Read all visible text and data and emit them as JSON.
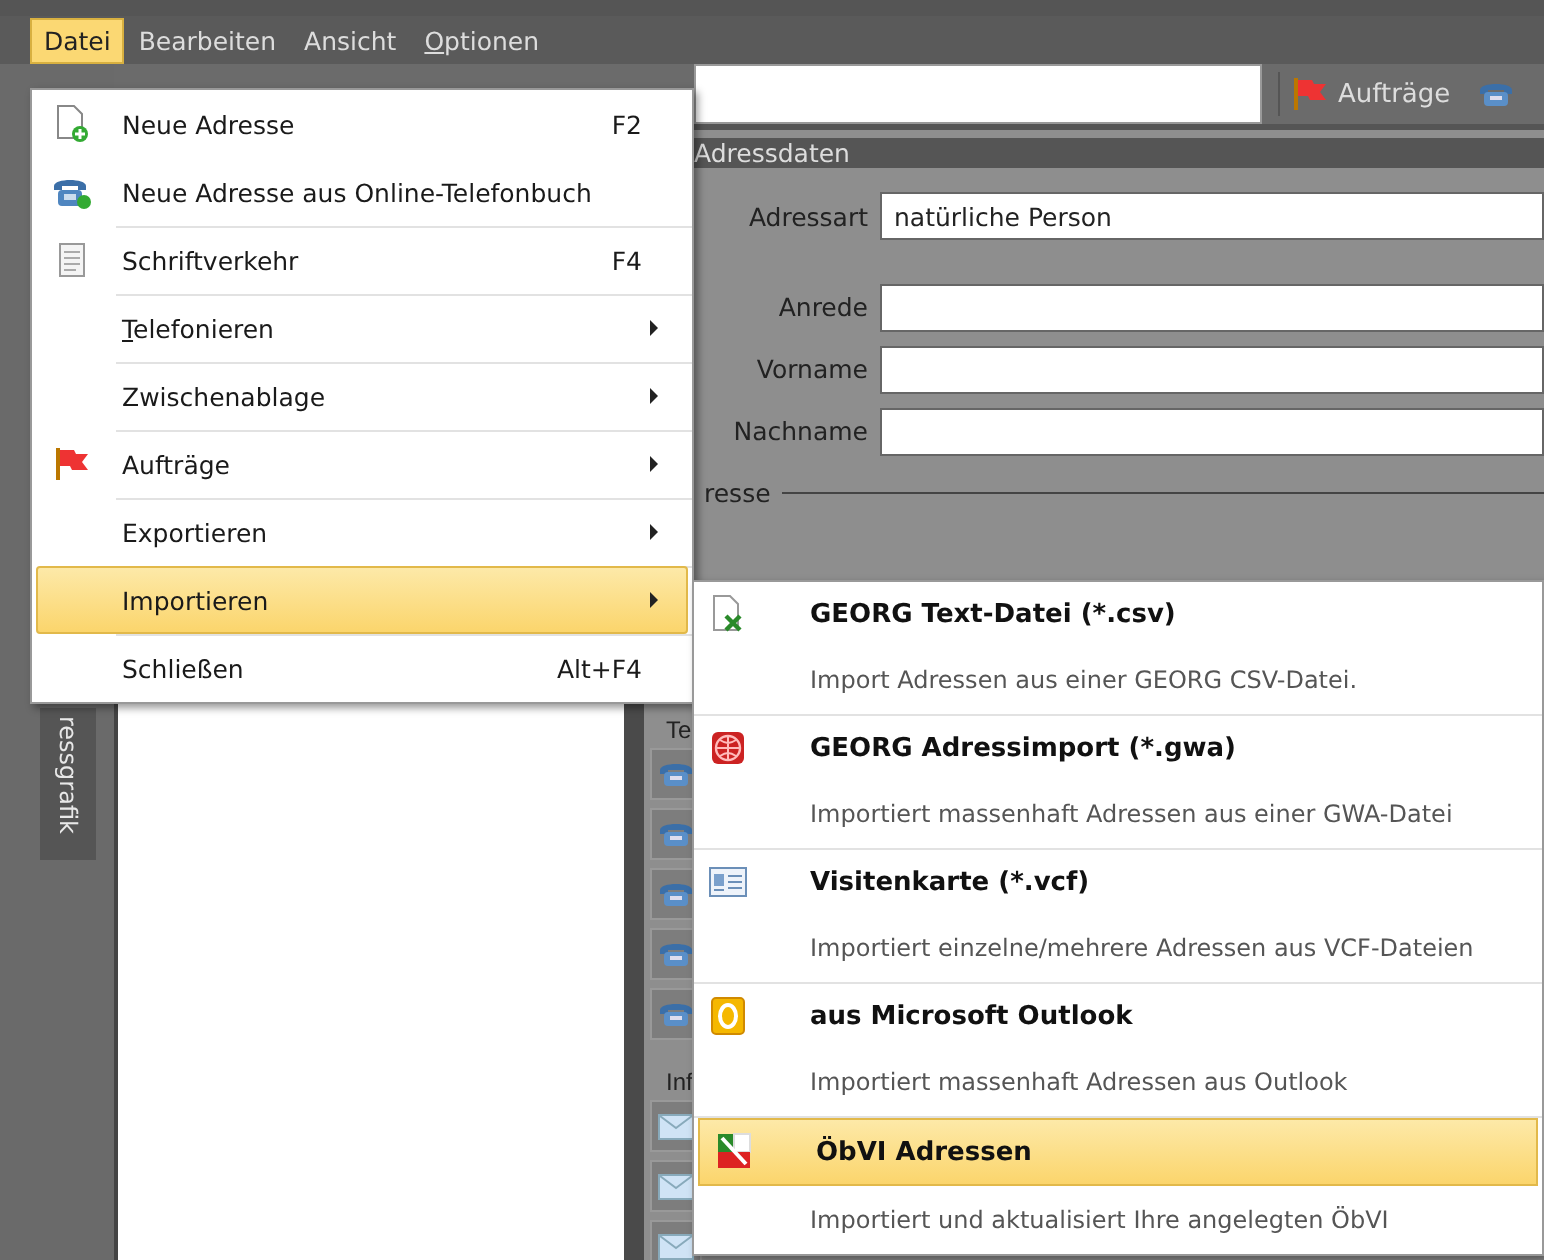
{
  "menubar": [
    {
      "label": "Datei",
      "selected": true,
      "mnemonic_underlined": false
    },
    {
      "label": "Bearbeiten",
      "selected": false,
      "mnemonic_underlined": false
    },
    {
      "label": "Ansicht",
      "selected": false,
      "mnemonic_underlined": false
    },
    {
      "label": "Optionen",
      "selected": false,
      "mnemonic_underlined": true
    }
  ],
  "toolbar": {
    "orders_button": "Aufträge"
  },
  "side_tab": "ressgrafik",
  "panel": {
    "title": "Adressdaten",
    "fields": [
      {
        "label": "Adressart",
        "value": "natürliche Person"
      },
      {
        "label": "Anrede"
      },
      {
        "label": "Vorname"
      },
      {
        "label": "Nachname"
      }
    ],
    "group_legend": "resse",
    "phone_label": "Te",
    "info_label": "Inf"
  },
  "file_menu": [
    {
      "label": "Neue Adresse",
      "shortcut": "F2",
      "submenu": false,
      "separator_before": false,
      "mnemonic_underlined": false,
      "selected": false
    },
    {
      "label": "Neue Adresse aus Online-Telefonbuch",
      "submenu": false,
      "separator_before": false,
      "mnemonic_underlined": false,
      "selected": false
    },
    {
      "label": "Schriftverkehr",
      "shortcut": "F4",
      "submenu": false,
      "separator_before": true,
      "mnemonic_underlined": false,
      "selected": false
    },
    {
      "label": "Telefonieren",
      "submenu": true,
      "separator_before": true,
      "mnemonic_underlined": true,
      "selected": false
    },
    {
      "label": "Zwischenablage",
      "submenu": true,
      "separator_before": true,
      "mnemonic_underlined": false,
      "selected": false
    },
    {
      "label": "Aufträge",
      "submenu": true,
      "separator_before": true,
      "mnemonic_underlined": false,
      "selected": false
    },
    {
      "label": "Exportieren",
      "submenu": true,
      "separator_before": true,
      "mnemonic_underlined": false,
      "selected": false
    },
    {
      "label": "Importieren",
      "submenu": true,
      "separator_before": true,
      "mnemonic_underlined": false,
      "selected": true
    },
    {
      "label": "Schließen",
      "shortcut": "Alt+F4",
      "submenu": false,
      "separator_before": true,
      "mnemonic_underlined": false,
      "selected": false
    }
  ],
  "import_menu": [
    {
      "title": "GEORG Text-Datei (*.csv)",
      "description": "Import Adressen aus einer GEORG CSV-Datei.",
      "selected": false
    },
    {
      "title": "GEORG Adressimport (*.gwa)",
      "description": "Importiert massenhaft Adressen aus einer GWA-Datei",
      "selected": false
    },
    {
      "title": "Visitenkarte (*.vcf)",
      "description": "Importiert einzelne/mehrere Adressen aus VCF-Dateien",
      "selected": false
    },
    {
      "title": "aus Microsoft Outlook",
      "description": "Importiert massenhaft Adressen aus Outlook",
      "selected": false
    },
    {
      "title": "ÖbVI Adressen",
      "description": "Importiert und aktualisiert Ihre angelegten ÖbVI",
      "selected": true
    }
  ]
}
